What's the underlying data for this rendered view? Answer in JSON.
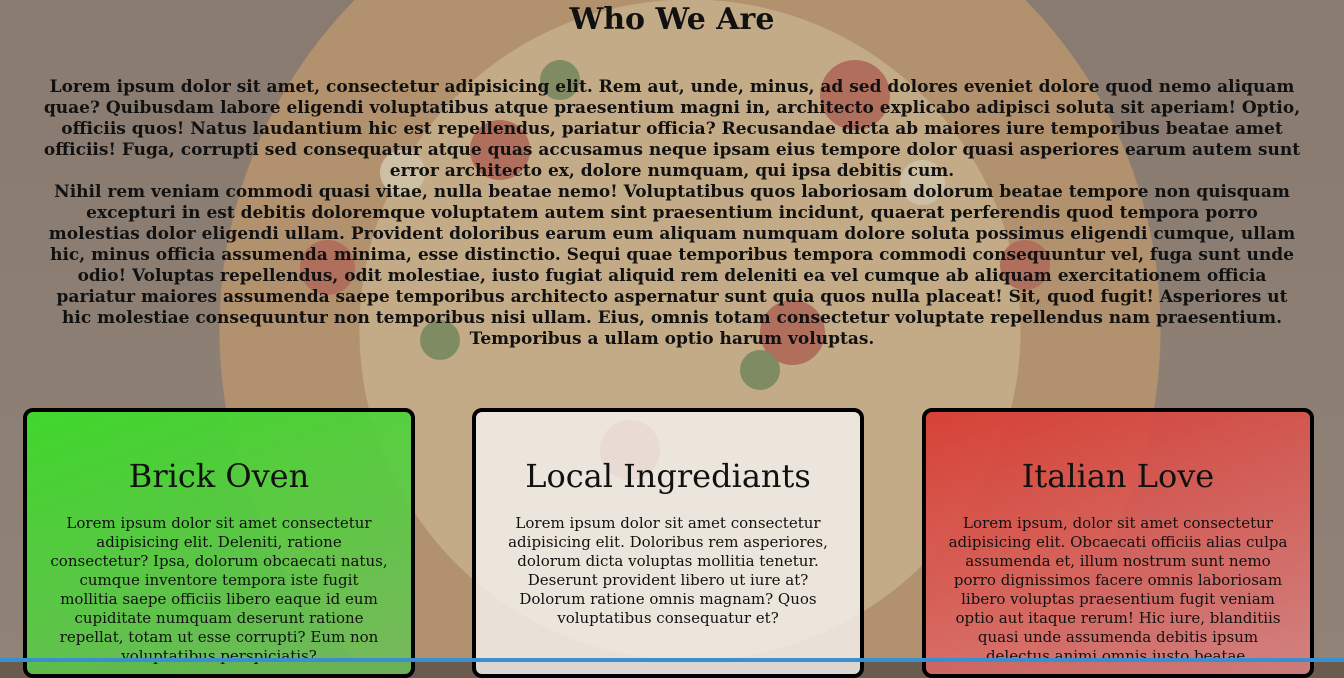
{
  "about": {
    "heading": "Who We Are",
    "paragraph_1": "Lorem ipsum dolor sit amet, consectetur adipisicing elit. Rem aut, unde, minus, ad sed dolores eveniet dolore quod nemo aliquam quae? Quibusdam labore eligendi voluptatibus atque praesentium magni in, architecto explicabo adipisci soluta sit aperiam! Optio, officiis quos! Natus laudantium hic est repellendus, pariatur officia? Recusandae dicta ab maiores iure temporibus beatae amet officiis! Fuga, corrupti sed consequatur atque quas accusamus neque ipsam eius tempore dolor quasi asperiores earum autem sunt error architecto ex, dolore numquam, qui ipsa debitis cum.",
    "paragraph_2": "Nihil rem veniam commodi quasi vitae, nulla beatae nemo! Voluptatibus quos laboriosam dolorum beatae tempore non quisquam excepturi in est debitis doloremque voluptatem autem sint praesentium incidunt, quaerat perferendis quod tempora porro molestias dolor eligendi ullam. Provident doloribus earum eum aliquam numquam dolore soluta possimus eligendi cumque, ullam hic, minus officia assumenda minima, esse distinctio. Sequi quae temporibus tempora commodi consequuntur vel, fuga sunt unde odio! Voluptas repellendus, odit molestiae, iusto fugiat aliquid rem deleniti ea vel cumque ab aliquam exercitationem officia pariatur maiores assumenda saepe temporibus architecto aspernatur sunt quia quos nulla placeat! Sit, quod fugit! Asperiores ut hic molestiae consequuntur non temporibus nisi ullam. Eius, omnis totam consectetur voluptate repellendus nam praesentium. Temporibus a ullam optio harum voluptas."
  },
  "cards": [
    {
      "title": "Brick Oven",
      "text": "Lorem ipsum dolor sit amet consectetur adipisicing elit. Deleniti, ratione consectetur? Ipsa, dolorum obcaecati natus, cumque inventore tempora iste fugit mollitia saepe officiis libero eaque id eum cupiditate numquam deserunt ratione repellat, totam ut esse corrupti? Eum non voluptatibus perspiciatis?",
      "color": "#3cdc28"
    },
    {
      "title": "Local Ingrediants",
      "text": "Lorem ipsum dolor sit amet consectetur adipisicing elit. Doloribus rem asperiores, dolorum dicta voluptas mollitia tenetur. Deserunt provident libero ut iure at? Dolorum ratione omnis magnam? Quos voluptatibus consequatur et?",
      "color": "#f5f2ee"
    },
    {
      "title": "Italian Love",
      "text": "Lorem ipsum, dolor sit amet consectetur adipisicing elit. Obcaecati officiis alias culpa assumenda et, illum nostrum sunt nemo porro dignissimos facere omnis laboriosam libero voluptas praesentium fugit veniam optio aut itaque rerum! Hic iure, blanditiis quasi unde assumenda debitis ipsum delectus animi omnis iusto beatae.",
      "color": "#d73c32"
    }
  ]
}
